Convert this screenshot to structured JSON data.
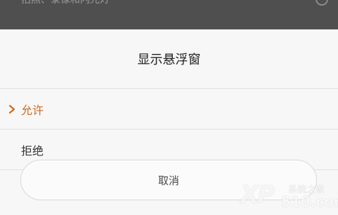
{
  "background": {
    "partial_text": "拍照、录像和闪光灯"
  },
  "dialog": {
    "title": "显示悬浮窗",
    "options": [
      {
        "label": "允许",
        "selected": true
      },
      {
        "label": "拒绝",
        "selected": false
      }
    ],
    "cancel_label": "取消"
  },
  "watermark": {
    "logo_text": "XP",
    "site_name": "系统之家",
    "site_number": "510.com"
  },
  "colors": {
    "accent": "#d0691c",
    "backdrop": "#4f4f4f",
    "sheet_background": "#f7f7f7"
  }
}
